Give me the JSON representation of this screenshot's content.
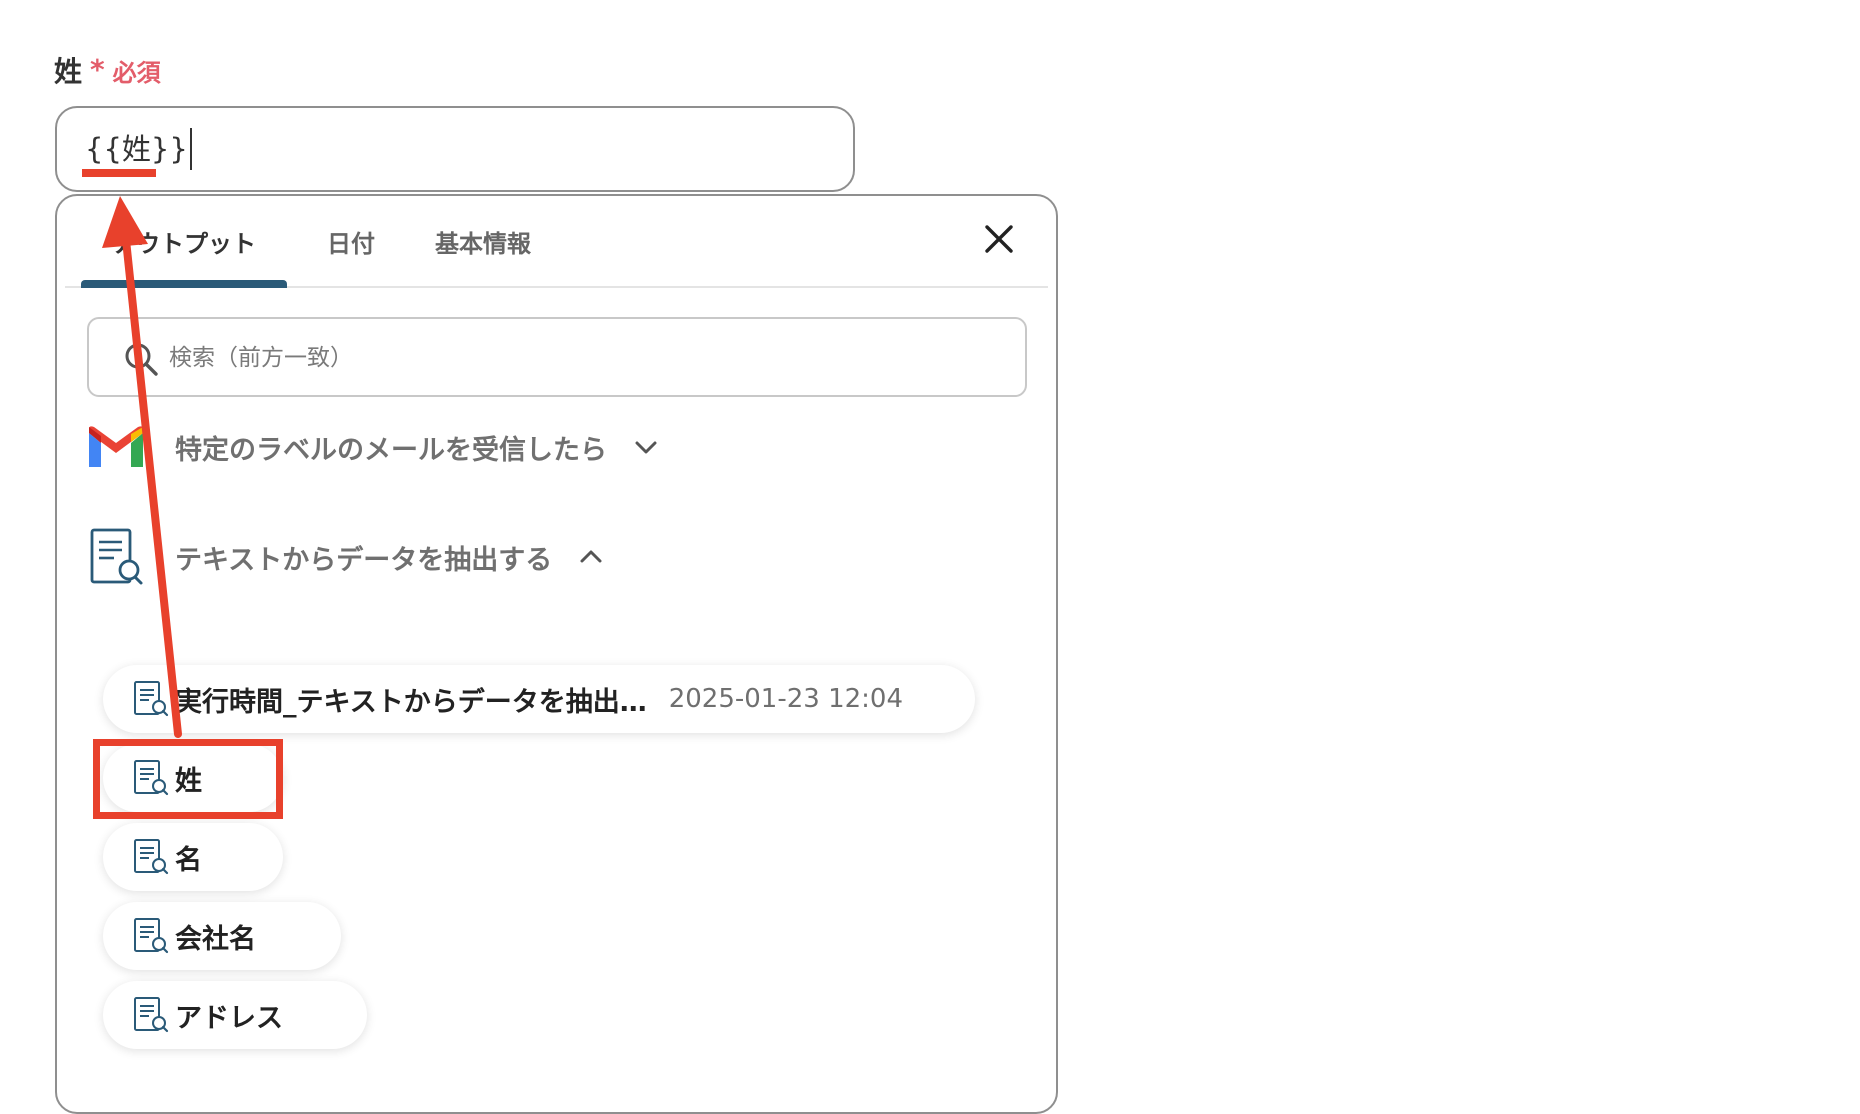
{
  "field": {
    "label": "姓",
    "required_mark": "*",
    "required_text": "必須",
    "value": "{{姓}}"
  },
  "dropdown": {
    "tabs": [
      {
        "label": "アウトプット",
        "active": true
      },
      {
        "label": "日付",
        "active": false
      },
      {
        "label": "基本情報",
        "active": false
      }
    ],
    "close_icon": "close-icon",
    "search": {
      "placeholder": "検索（前方一致）",
      "value": ""
    },
    "sections": [
      {
        "title": "特定のラベルのメールを受信したら",
        "icon": "gmail-icon",
        "expanded": false
      },
      {
        "title": "テキストからデータを抽出する",
        "icon": "text-extract-icon",
        "expanded": true
      }
    ],
    "items": [
      {
        "label": "実行時間_テキストからデータを抽出…",
        "value": "2025-01-23 12:04"
      },
      {
        "label": "姓",
        "value": ""
      },
      {
        "label": "名",
        "value": ""
      },
      {
        "label": "会社名",
        "value": ""
      },
      {
        "label": "アドレス",
        "value": ""
      }
    ]
  },
  "colors": {
    "required": "#e35d6a",
    "annotation": "#e8412c",
    "tab_indicator": "#2a5a78",
    "icon": "#2a5a78"
  }
}
